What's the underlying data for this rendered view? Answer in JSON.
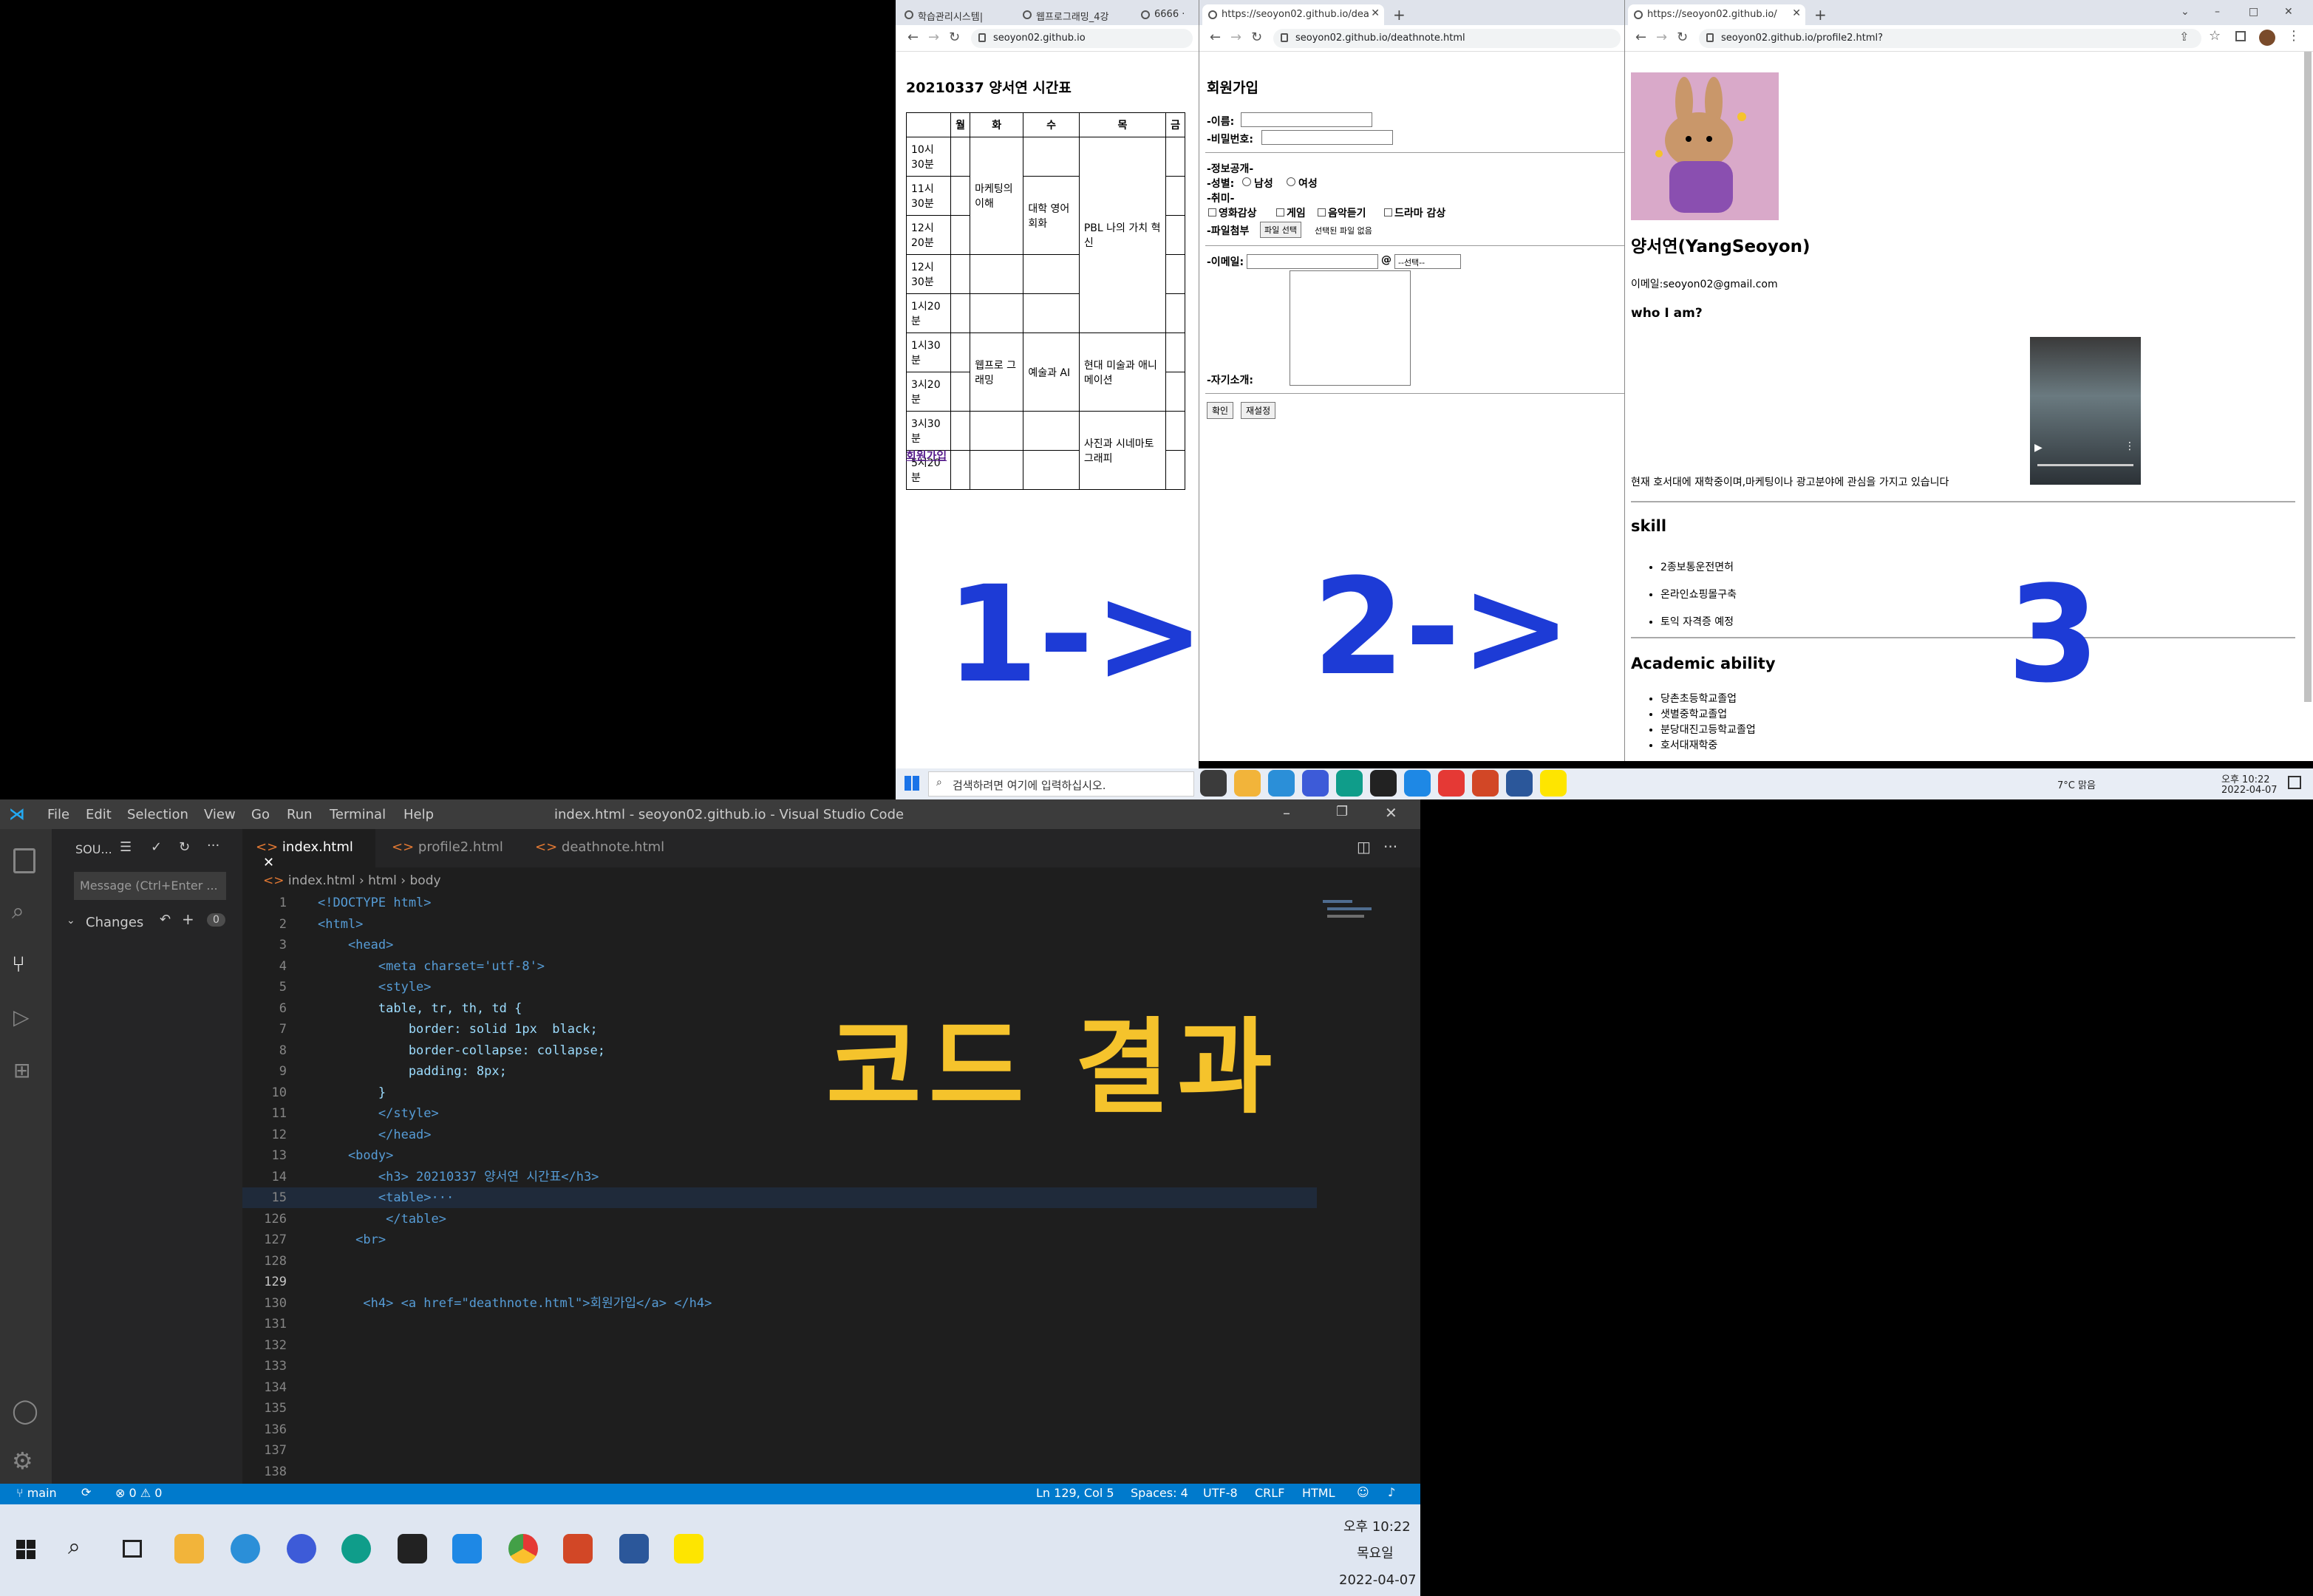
{
  "browser1": {
    "tabs": [
      "학습관리시스템|",
      "웹프로그래밍_4강",
      "6666 · "
    ],
    "url": "seoyon02.github.io",
    "title": "20210337 양서연 시간표",
    "table": {
      "headers": [
        "",
        "월",
        "화",
        "수",
        "목",
        "금"
      ],
      "times": [
        "10시30분",
        "11시30분",
        "12시20분",
        "12시30분",
        "1시20분",
        "1시30분",
        "3시20분",
        "3시30분",
        "5시20분"
      ],
      "cells": {
        "marketing": "마케팅의 이해",
        "english": "대학 영어 회화",
        "pbl": "PBL 나의 가치 혁신",
        "webprog": "웹프로 그래밍",
        "artai": "예술과 AI",
        "modern": "현대 미술과 애니 메이션",
        "photo": "사진과 시네마토 그래피"
      }
    },
    "link": "회원가입"
  },
  "browser2": {
    "tab": "https://seoyon02.github.io/dea",
    "url": "seoyon02.github.io/deathnote.html",
    "title": "회원가입",
    "name_label": "-이름:",
    "pw_label": "-비밀번호:",
    "info_label": "-정보공개-",
    "gender_label": "-성별:",
    "male": "남성",
    "female": "여성",
    "hobby_label": "-취미-",
    "hobbies": [
      "영화감상",
      "게임",
      "음악듣기",
      "드라마 감상"
    ],
    "file_label": "-파일첨부",
    "file_button": "파일 선택",
    "file_status": "선택된 파일 없음",
    "email_label": "-이메일:",
    "at": "@",
    "select": "--선택--",
    "intro_label": "-자기소개:",
    "ok": "확인",
    "reset": "재설정"
  },
  "browser3": {
    "tab": "https://seoyon02.github.io/",
    "url": "seoyon02.github.io/profile2.html?",
    "name": "양서연(YangSeoyon)",
    "email": "이메일:seoyon02@gmail.com",
    "who": "who I am?",
    "desc": "현재 호서대에 재학중이며,마케팅이나 광고분야에 관심을 가지고 있습니다",
    "skill_title": "skill",
    "skills": [
      "2종보통운전면허",
      "온라인쇼핑몰구축",
      "토익 자격증 예정"
    ],
    "academic_title": "Academic ability",
    "academics": [
      "당촌초등학교졸업",
      "샛별중학교졸업",
      "분당대진고등학교졸업",
      "호서대재학중"
    ],
    "window_controls": [
      "⌄",
      "–",
      "□",
      "✕"
    ]
  },
  "annotations": {
    "one": "1->",
    "two": "2->",
    "three": "3",
    "code_result": "코드 결과"
  },
  "taskbar_top": {
    "search": "검색하려면 여기에 입력하십시오.",
    "weather": "7°C 맑음",
    "time": "오후 10:22",
    "date": "2022-04-07"
  },
  "vscode": {
    "menu": [
      "File",
      "Edit",
      "Selection",
      "View",
      "Go",
      "Run",
      "Terminal",
      "Help"
    ],
    "title": "index.html - seoyon02.github.io - Visual Studio Code",
    "sidebar_title": "SOU...",
    "message_placeholder": "Message (Ctrl+Enter ...",
    "changes": "Changes",
    "changes_count": "0",
    "tabs": [
      "index.html",
      "profile2.html",
      "deathnote.html"
    ],
    "breadcrumb": [
      "index.html",
      "html",
      "body"
    ],
    "lines": [
      {
        "n": "1",
        "t": "<!DOCTYPE html>"
      },
      {
        "n": "2",
        "t": "<html>"
      },
      {
        "n": "3",
        "t": "    <head>"
      },
      {
        "n": "4",
        "t": "        <meta charset='utf-8'>"
      },
      {
        "n": "5",
        "t": "        <style>"
      },
      {
        "n": "6",
        "t": "        table, tr, th, td {"
      },
      {
        "n": "7",
        "t": "            border: solid 1px  black;"
      },
      {
        "n": "8",
        "t": "            border-collapse: collapse;"
      },
      {
        "n": "9",
        "t": "            padding: 8px;"
      },
      {
        "n": "10",
        "t": "        }"
      },
      {
        "n": "11",
        "t": "        </style>"
      },
      {
        "n": "12",
        "t": "        </head>"
      },
      {
        "n": "13",
        "t": "    <body>"
      },
      {
        "n": "14",
        "t": "        <h3> 20210337 양서연 시간표</h3>"
      },
      {
        "n": "15",
        "t": "        <table>···"
      },
      {
        "n": "126",
        "t": "         </table>"
      },
      {
        "n": "127",
        "t": "     <br>"
      },
      {
        "n": "128",
        "t": ""
      },
      {
        "n": "129",
        "t": ""
      },
      {
        "n": "130",
        "t": "      <h4> <a href=\"deathnote.html\">회원가입</a> </h4>"
      },
      {
        "n": "131",
        "t": ""
      },
      {
        "n": "132",
        "t": ""
      },
      {
        "n": "133",
        "t": ""
      },
      {
        "n": "134",
        "t": ""
      },
      {
        "n": "135",
        "t": ""
      },
      {
        "n": "136",
        "t": ""
      },
      {
        "n": "137",
        "t": ""
      },
      {
        "n": "138",
        "t": ""
      }
    ],
    "status": {
      "branch": "main",
      "errors": "0",
      "warnings": "0",
      "position": "Ln 129, Col 5",
      "spaces": "Spaces: 4",
      "encoding": "UTF-8",
      "eol": "CRLF",
      "lang": "HTML"
    }
  },
  "taskbar_bottom": {
    "time": "오후 10:22",
    "day": "목요일",
    "date": "2022-04-07"
  },
  "colors": {
    "accent": "#1d3bd6",
    "annotation_yellow": "#f5c32c",
    "vscode_status": "#007acc"
  }
}
